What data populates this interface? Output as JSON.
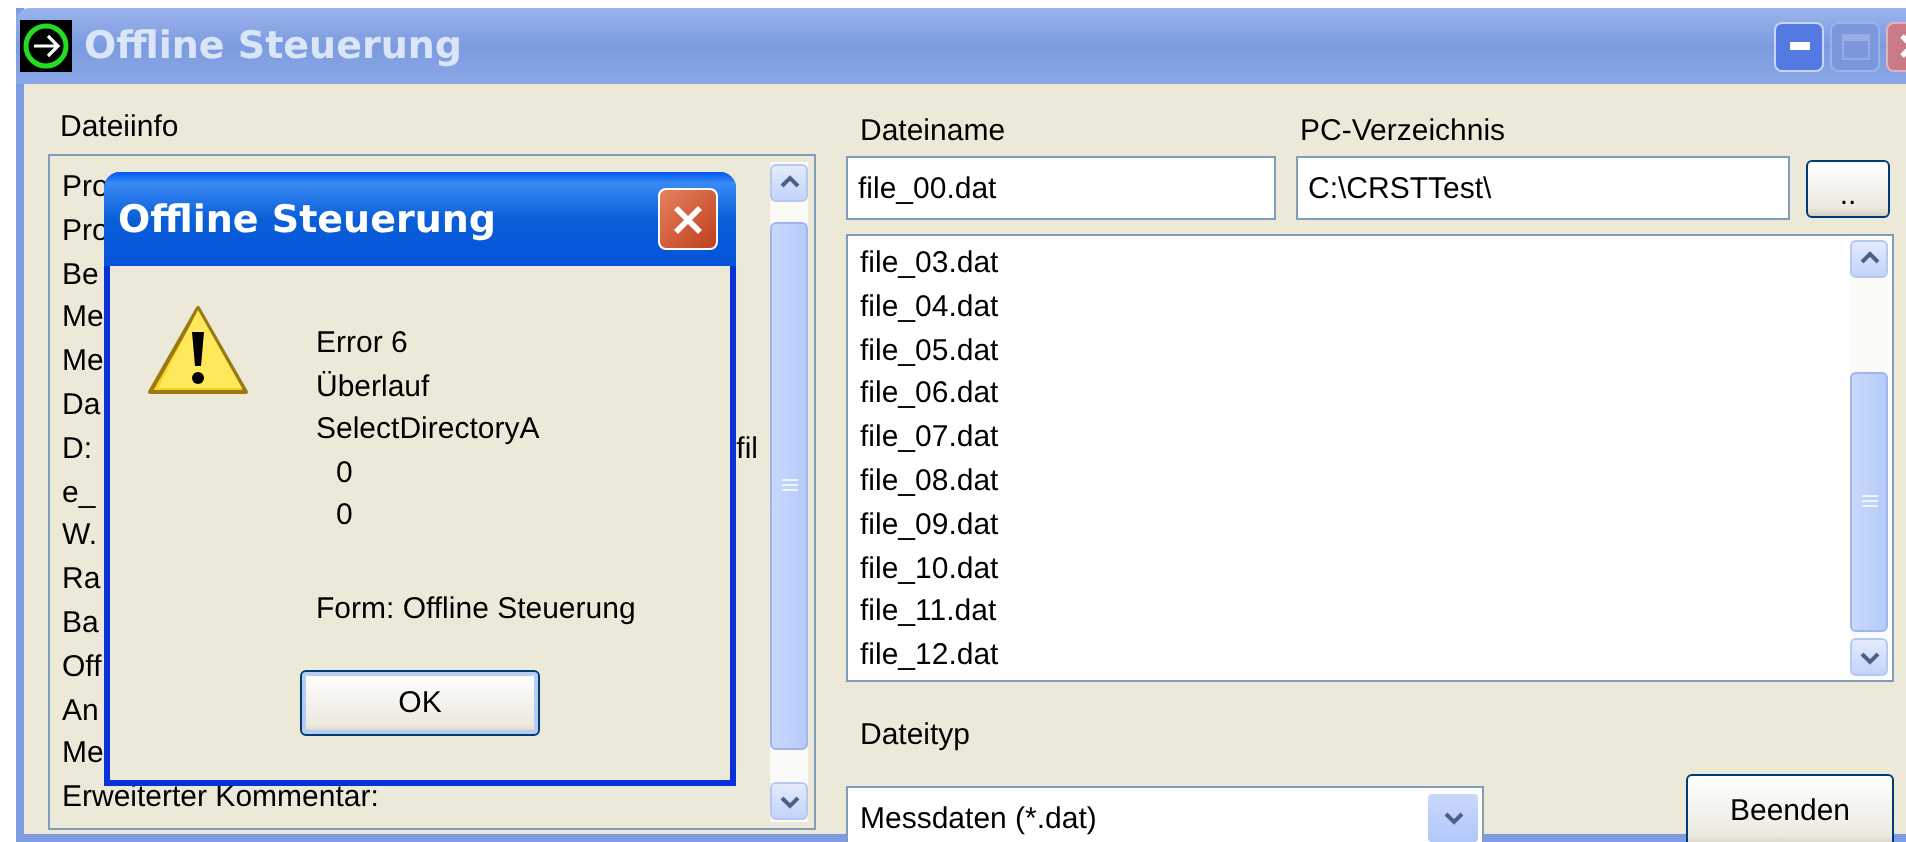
{
  "window": {
    "title": "Offline Steuerung",
    "active": false
  },
  "file_info": {
    "label": "Dateiinfo",
    "lines": [
      {
        "text": "Pro"
      },
      {
        "text": "Pro"
      },
      {
        "text": "Be"
      },
      {
        "text": "Me"
      },
      {
        "text": "Me"
      },
      {
        "text": "Da"
      },
      {
        "text": "D:",
        "tail": "fil"
      },
      {
        "text": "e_"
      },
      {
        "text": "W."
      },
      {
        "text": "Ra"
      },
      {
        "text": "Ba"
      },
      {
        "text": "Off"
      },
      {
        "text": "An"
      },
      {
        "text": "Me"
      },
      {
        "text": "Erweiterter Kommentar:"
      }
    ]
  },
  "file_name": {
    "label": "Dateiname",
    "value": "file_00.dat"
  },
  "pc_directory": {
    "label": "PC-Verzeichnis",
    "value": "C:\\CRSTTest\\",
    "browse_button": ".."
  },
  "files": [
    "file_03.dat",
    "file_04.dat",
    "file_05.dat",
    "file_06.dat",
    "file_07.dat",
    "file_08.dat",
    "file_09.dat",
    "file_10.dat",
    "file_11.dat",
    "file_12.dat"
  ],
  "file_type": {
    "label": "Dateityp",
    "value": "Messdaten (*.dat)"
  },
  "exit_button": "Beenden",
  "dialog": {
    "title": "Offline Steuerung",
    "active": true,
    "lines": [
      {
        "text": "Error 6",
        "kind": "message"
      },
      {
        "text": "Überlauf",
        "kind": "message"
      },
      {
        "text": "SelectDirectoryA",
        "kind": "message"
      },
      {
        "text": "0",
        "kind": "value"
      },
      {
        "text": "0",
        "kind": "value"
      },
      {
        "text": "Form: Offline Steuerung",
        "kind": "footer"
      }
    ],
    "button": "OK"
  }
}
